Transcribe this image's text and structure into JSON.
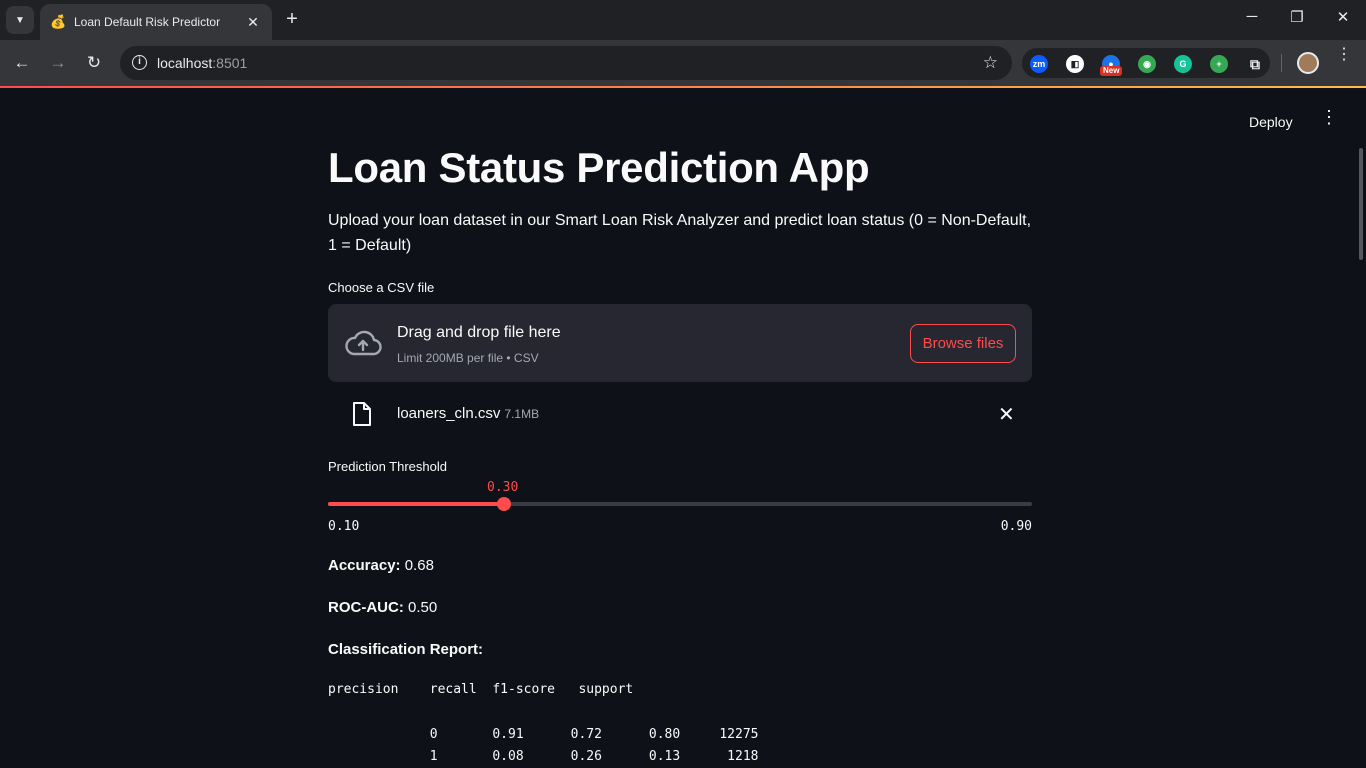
{
  "browser": {
    "tab_title": "Loan Default Risk Predictor",
    "tab_favicon": "money-bag-icon",
    "url_host": "localhost",
    "url_port": ":8501",
    "extensions": [
      {
        "name": "zoom-extension-icon",
        "label": "zm",
        "color": "#0b5cff"
      },
      {
        "name": "extension-2-icon",
        "label": "◧",
        "color": "#ffffff"
      },
      {
        "name": "extension-3-icon",
        "label": "●",
        "color": "#1a73e8"
      },
      {
        "name": "extension-4-icon",
        "label": "◉",
        "color": "#34a853"
      },
      {
        "name": "grammarly-icon",
        "label": "G",
        "color": "#15c39a"
      },
      {
        "name": "add-extension-icon",
        "label": "+",
        "color": "#34a853"
      }
    ],
    "new_badge": "New"
  },
  "app": {
    "deploy_label": "Deploy",
    "title": "Loan Status Prediction App",
    "description": "Upload your loan dataset in our Smart Loan Risk Analyzer and predict loan status (0 = Non-Default, 1 = Default)",
    "uploader": {
      "label": "Choose a CSV file",
      "drop_text": "Drag and drop file here",
      "limit_text": "Limit 200MB per file • CSV",
      "browse_label": "Browse files"
    },
    "file": {
      "name": "loaners_cln.csv",
      "size": "7.1MB"
    },
    "slider": {
      "label": "Prediction Threshold",
      "value": "0.30",
      "min": "0.10",
      "max": "0.90",
      "fraction": 0.25,
      "accent": "#ff4b4b"
    },
    "metrics": {
      "accuracy_label": "Accuracy:",
      "accuracy_value": " 0.68",
      "roc_label": "ROC-AUC:",
      "roc_value": " 0.50",
      "report_label": "Classification Report:"
    },
    "report": {
      "header": "precision    recall  f1-score   support",
      "rows": [
        {
          "label": "0",
          "precision": "0.91",
          "recall": "0.72",
          "f1": "0.80",
          "support": "12275"
        },
        {
          "label": "1",
          "precision": "0.08",
          "recall": "0.26",
          "f1": "0.13",
          "support": "1218"
        }
      ]
    }
  }
}
